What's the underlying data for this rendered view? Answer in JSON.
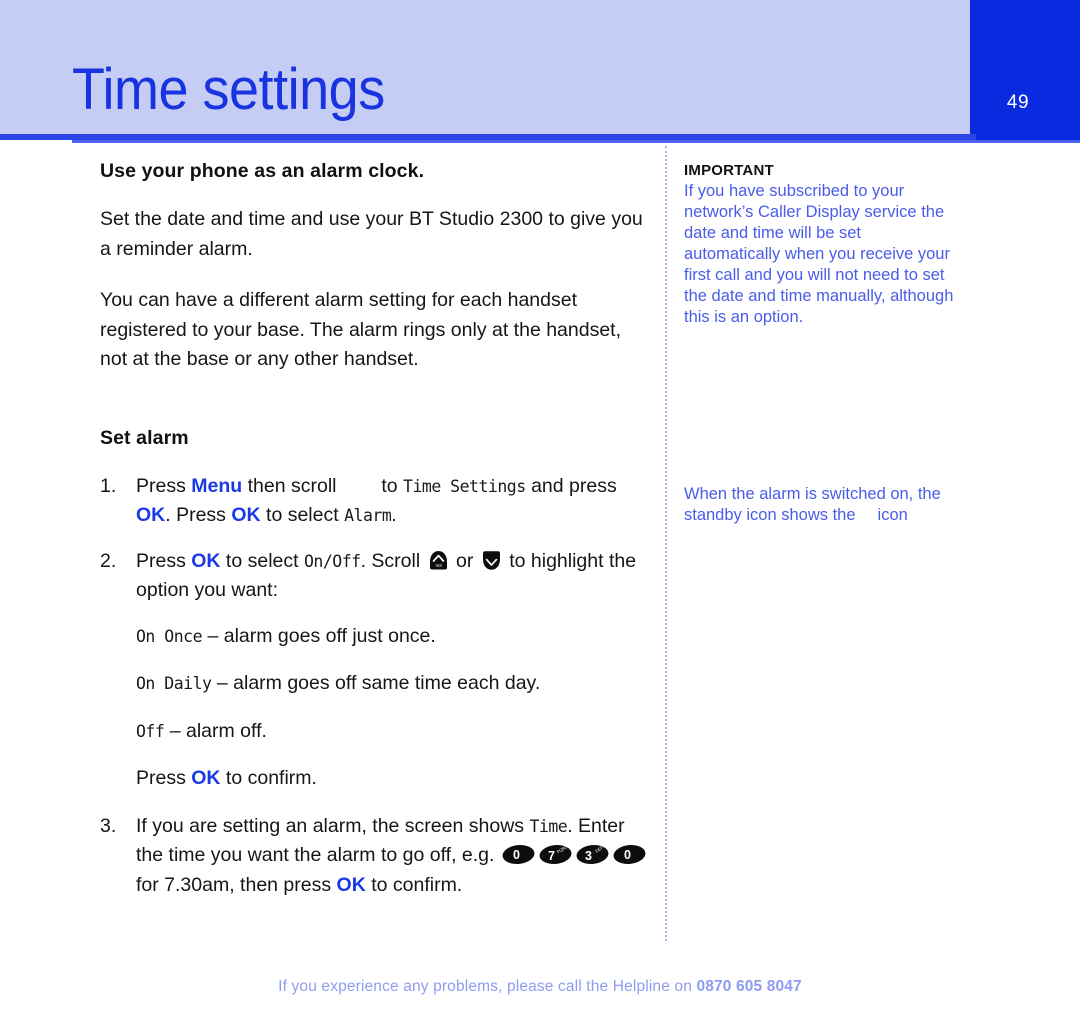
{
  "page": {
    "title": "Time settings",
    "number": "49",
    "accent_blue": "#1a33e0",
    "header_band": "#c6cdf5",
    "rule_blue": "#2a44e8",
    "sidebar_text_blue": "#4a5ce8",
    "footer_blue": "#8e9cf0"
  },
  "main": {
    "heading": "Use your phone as an alarm clock.",
    "intro_1": "Set the date and time and use your BT Studio 2300 to give you a reminder alarm.",
    "intro_2": "You can have a different alarm setting for each handset registered to your base. The alarm rings only at the handset, not at the base or any other handset.",
    "set_alarm_heading": "Set alarm",
    "steps": [
      {
        "num": "1.",
        "seg1": "Press ",
        "menu": "Menu",
        "seg2": " then scroll ",
        "seg3": " to ",
        "lcd1": "Time Settings",
        "seg4": " and press ",
        "ok1": "OK",
        "seg5": ". Press ",
        "ok2": "OK",
        "seg6": " to select ",
        "lcd2": "Alarm",
        "seg7": "."
      },
      {
        "num": "2.",
        "seg1": "Press ",
        "ok1": "OK",
        "seg2": " to select ",
        "lcd1": "On/Off",
        "seg3": ". Scroll ",
        "seg4": " or ",
        "seg5": " to highlight the option you want:"
      },
      {
        "num": "3.",
        "seg1": "If you are setting an alarm, the screen shows ",
        "lcd1": "Time",
        "seg2": ". Enter the time you want the alarm to go off, e.g. ",
        "seg3": " for 7.30am, then press ",
        "ok1": "OK",
        "seg4": " to confirm."
      }
    ],
    "options": [
      {
        "lcd": "On Once",
        "text": " – alarm goes off just once."
      },
      {
        "lcd": "On Daily",
        "text": " – alarm goes off same time each day."
      },
      {
        "lcd": "Off",
        "text": " – alarm off."
      }
    ],
    "confirm_line": {
      "pre": "Press ",
      "ok": "OK",
      "post": " to confirm."
    },
    "keypad_sequence": [
      {
        "digit": "0",
        "letters": ""
      },
      {
        "digit": "7",
        "letters": "PQRS"
      },
      {
        "digit": "3",
        "letters": "DEF"
      },
      {
        "digit": "0",
        "letters": ""
      }
    ],
    "scroll_keys": {
      "up_label": "Vol",
      "up_icon": "scroll-up-key-icon",
      "down_icon": "scroll-down-key-icon"
    }
  },
  "sidebar": {
    "important_label": "IMPORTANT",
    "important_text": "If you have subscribed to your network’s Caller Display service the date and time will be set automatically when you receive your first call and you will not need to set the date and time manually, although this is an option.",
    "note_part1": "When the alarm is switched on, the standby icon shows the",
    "note_part2": "icon"
  },
  "footer": {
    "text": "If you experience any problems, please call the Helpline on ",
    "phone": "0870 605 8047"
  }
}
